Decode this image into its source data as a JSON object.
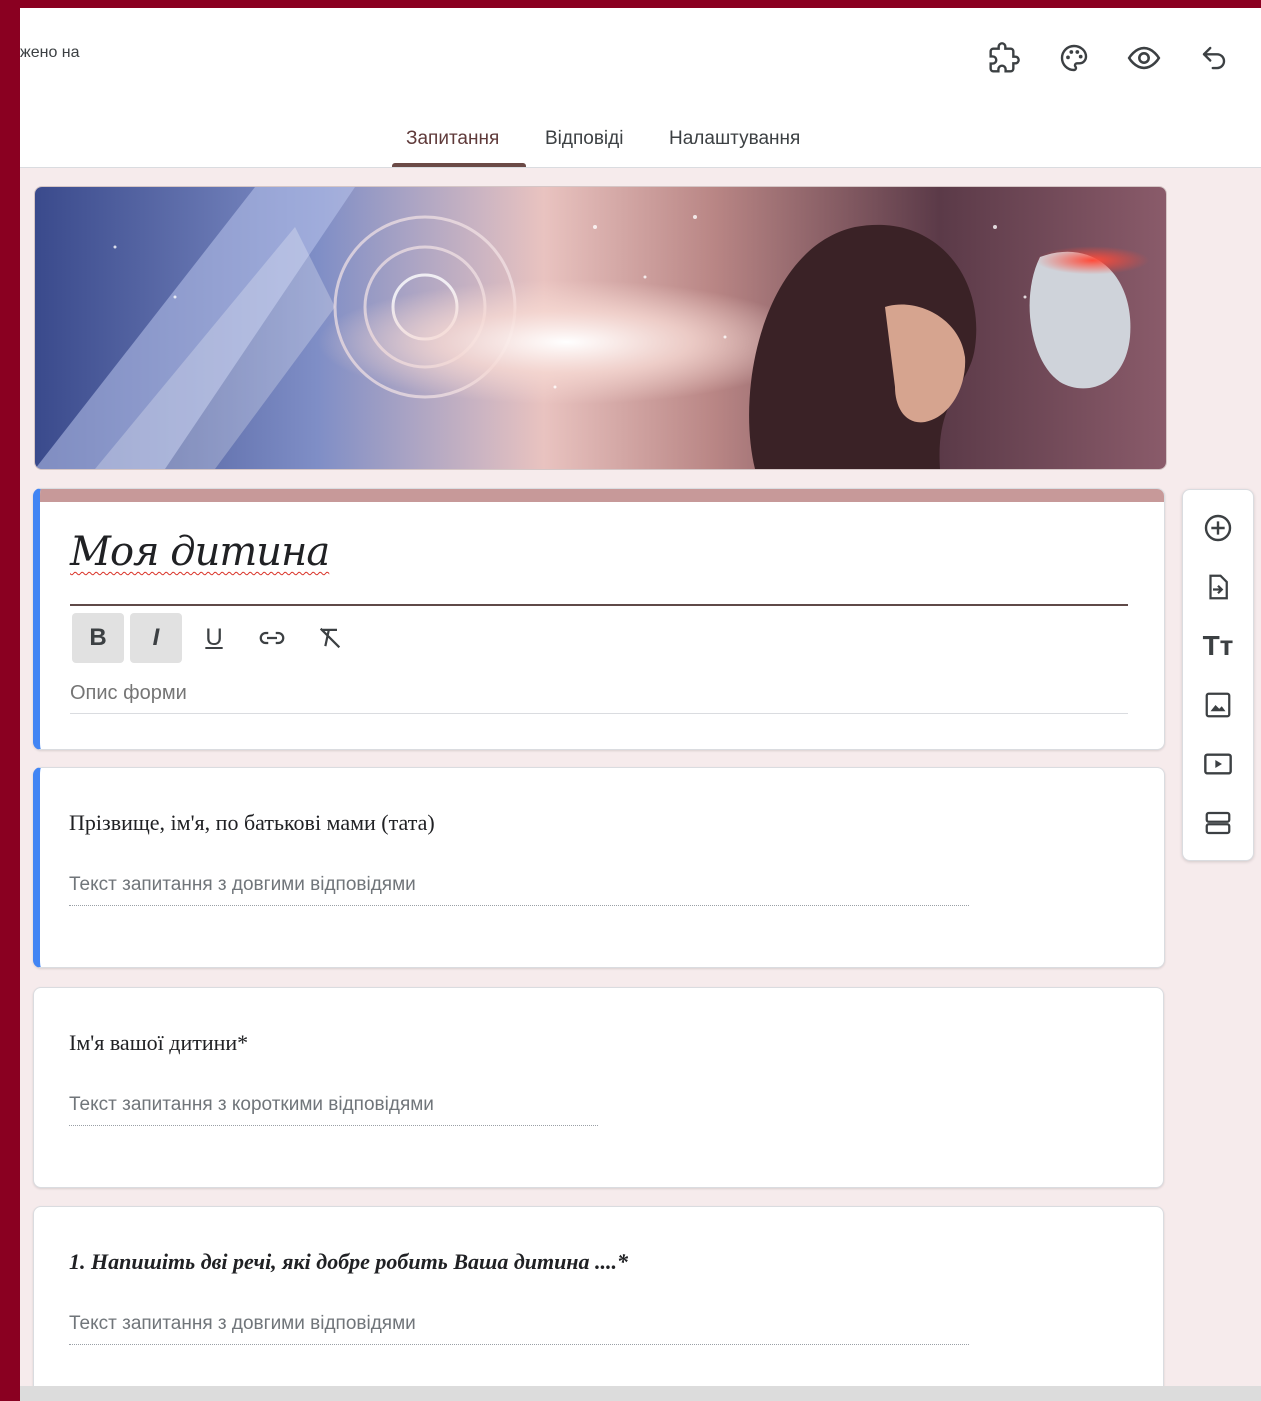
{
  "header": {
    "saved_text": "жено на",
    "icons": [
      "puzzle-icon",
      "palette-icon",
      "eye-icon",
      "undo-icon"
    ]
  },
  "tabs": [
    {
      "label": "Запитання",
      "active": true
    },
    {
      "label": "Відповіді",
      "active": false
    },
    {
      "label": "Налаштування",
      "active": false
    }
  ],
  "form": {
    "title": "Моя дитина",
    "description_placeholder": "Опис форми",
    "format_buttons": [
      "B",
      "I",
      "U",
      "link",
      "clear-format"
    ],
    "accent_color": "#4285f4",
    "theme_color": "#c79999"
  },
  "questions": [
    {
      "title": "Прізвище, ім'я, по батькові мами (тата)",
      "answer_hint": "Текст запитання з довгими відповідями"
    },
    {
      "title": "Ім'я вашої дитини*",
      "answer_hint": "Текст запитання з короткими відповідями"
    },
    {
      "title": "1. Напишіть дві речі, які добре робить Ваша дитина ....*",
      "answer_hint": "Текст запитання з довгими відповідями"
    }
  ],
  "side_toolbar": [
    "add-question-icon",
    "import-questions-icon",
    "add-title-icon",
    "add-image-icon",
    "add-video-icon",
    "add-section-icon"
  ]
}
